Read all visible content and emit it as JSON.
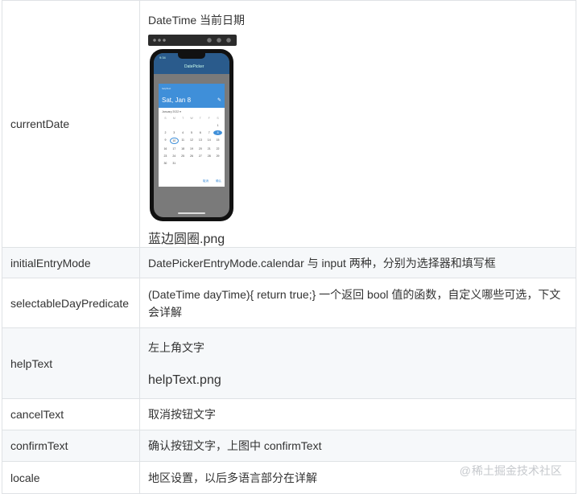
{
  "rows": [
    {
      "name": "currentDate",
      "desc_lines": [
        "DateTime 当前日期"
      ],
      "image_label": "蓝边圆圈.png",
      "phone": {
        "status_time": "9:34",
        "appbar_title": "DatePicker",
        "help_text": "helpText",
        "selected_date": "Sat, Jan 8",
        "month": "January 2022 ▾",
        "weekdays": [
          "S",
          "M",
          "T",
          "W",
          "T",
          "F",
          "S"
        ],
        "days": [
          "",
          "",
          "",
          "",
          "",
          "",
          "1",
          "2",
          "3",
          "4",
          "5",
          "6",
          "7",
          "8",
          "9",
          "10",
          "11",
          "12",
          "13",
          "14",
          "15",
          "16",
          "17",
          "18",
          "19",
          "20",
          "21",
          "22",
          "23",
          "24",
          "25",
          "26",
          "27",
          "28",
          "29",
          "30",
          "31",
          "",
          "",
          "",
          "",
          ""
        ],
        "cancel": "取消",
        "confirm": "确认"
      }
    },
    {
      "name": "initialEntryMode",
      "desc": "DatePickerEntryMode.calendar 与 input 两种，分别为选择器和填写框"
    },
    {
      "name": "selectableDayPredicate",
      "desc": "(DateTime dayTime){ return true;} 一个返回 bool 值的函数，自定义哪些可选，下文会详解"
    },
    {
      "name": "helpText",
      "desc": "左上角文字",
      "image_label": "helpText.png"
    },
    {
      "name": "cancelText",
      "desc": "取消按钮文字"
    },
    {
      "name": "confirmText",
      "desc": "确认按钮文字，上图中 confirmText"
    },
    {
      "name": "locale",
      "desc": "地区设置，以后多语言部分在详解"
    }
  ],
  "watermark": "稀土掘金技术社区",
  "watermark_icon": "at-icon"
}
